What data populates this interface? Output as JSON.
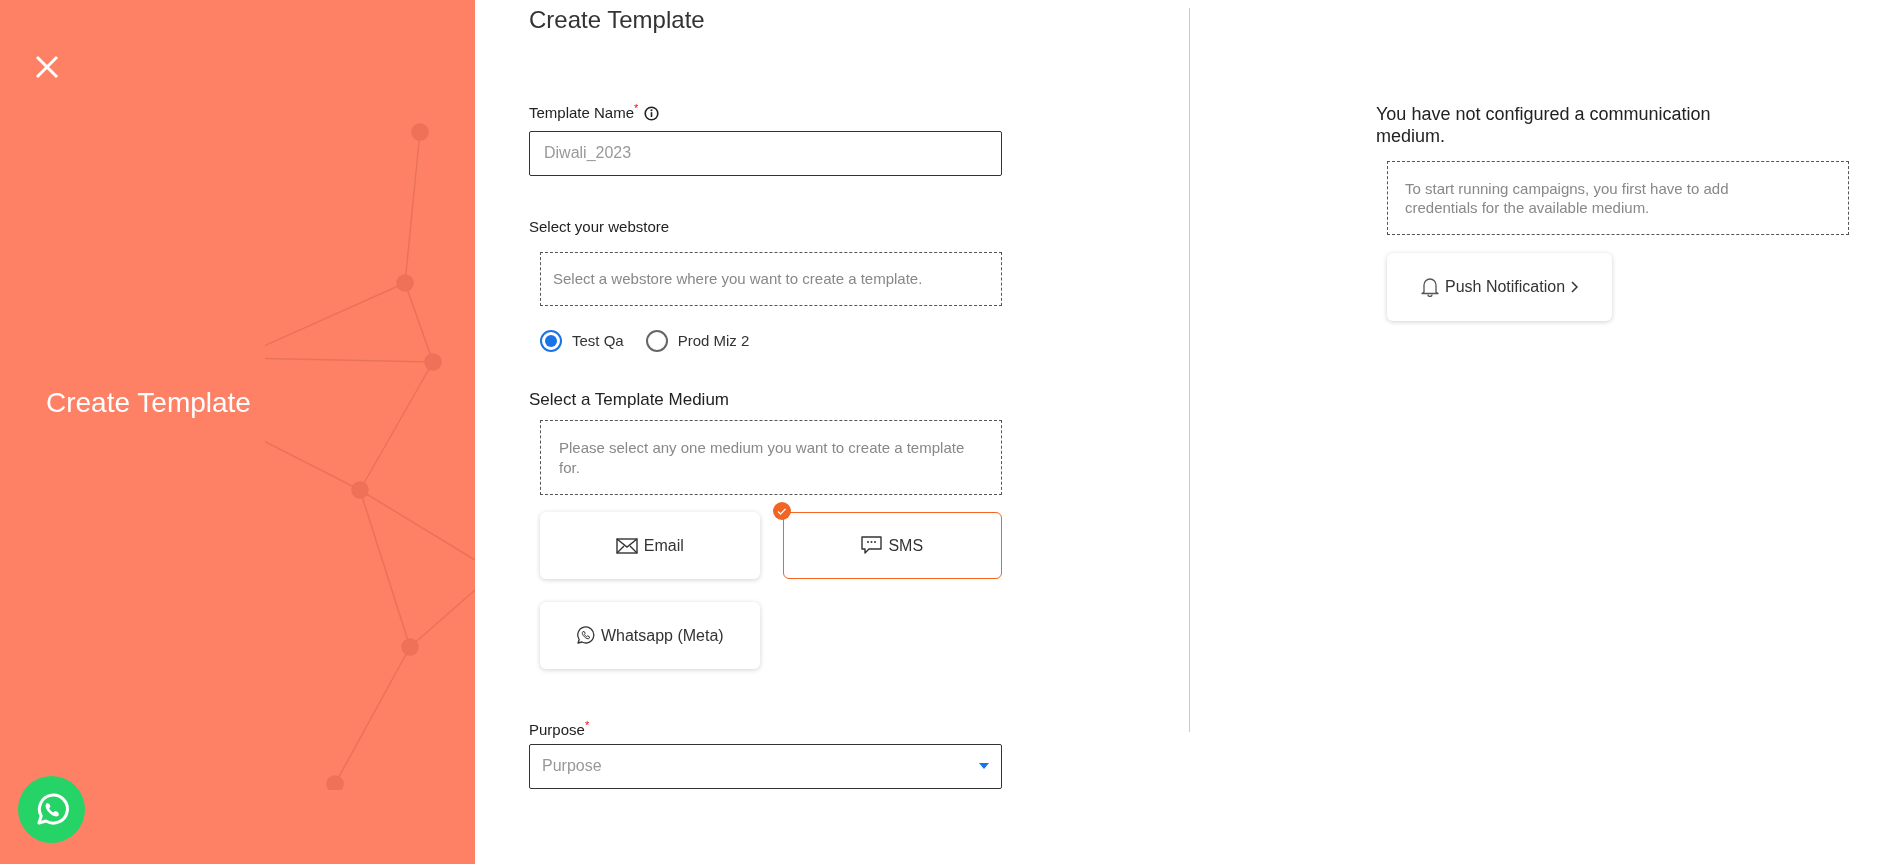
{
  "sidebar": {
    "title": "Create Template"
  },
  "form": {
    "title": "Create Template",
    "template_name": {
      "label": "Template Name",
      "required_mark": "*",
      "placeholder": "Diwali_2023"
    },
    "webstore": {
      "label": "Select your webstore",
      "hint": "Select a webstore where you want to create a template.",
      "options": [
        {
          "label": "Test Qa",
          "selected": true
        },
        {
          "label": "Prod Miz 2",
          "selected": false
        }
      ]
    },
    "medium": {
      "label": "Select a Template Medium",
      "hint": "Please select any one medium you want to create a template for.",
      "options": [
        {
          "label": "Email",
          "kind": "email",
          "selected": false
        },
        {
          "label": "SMS",
          "kind": "sms",
          "selected": true
        },
        {
          "label": "Whatsapp (Meta)",
          "kind": "whatsapp",
          "selected": false
        }
      ]
    },
    "purpose": {
      "label": "Purpose",
      "required_mark": "*",
      "placeholder": "Purpose"
    }
  },
  "notice": {
    "title": "You have not configured a communication medium.",
    "hint": "To start running campaigns, you first have to add credentials for the available medium.",
    "mediums": [
      {
        "label": "Push Notification",
        "kind": "push"
      }
    ]
  }
}
